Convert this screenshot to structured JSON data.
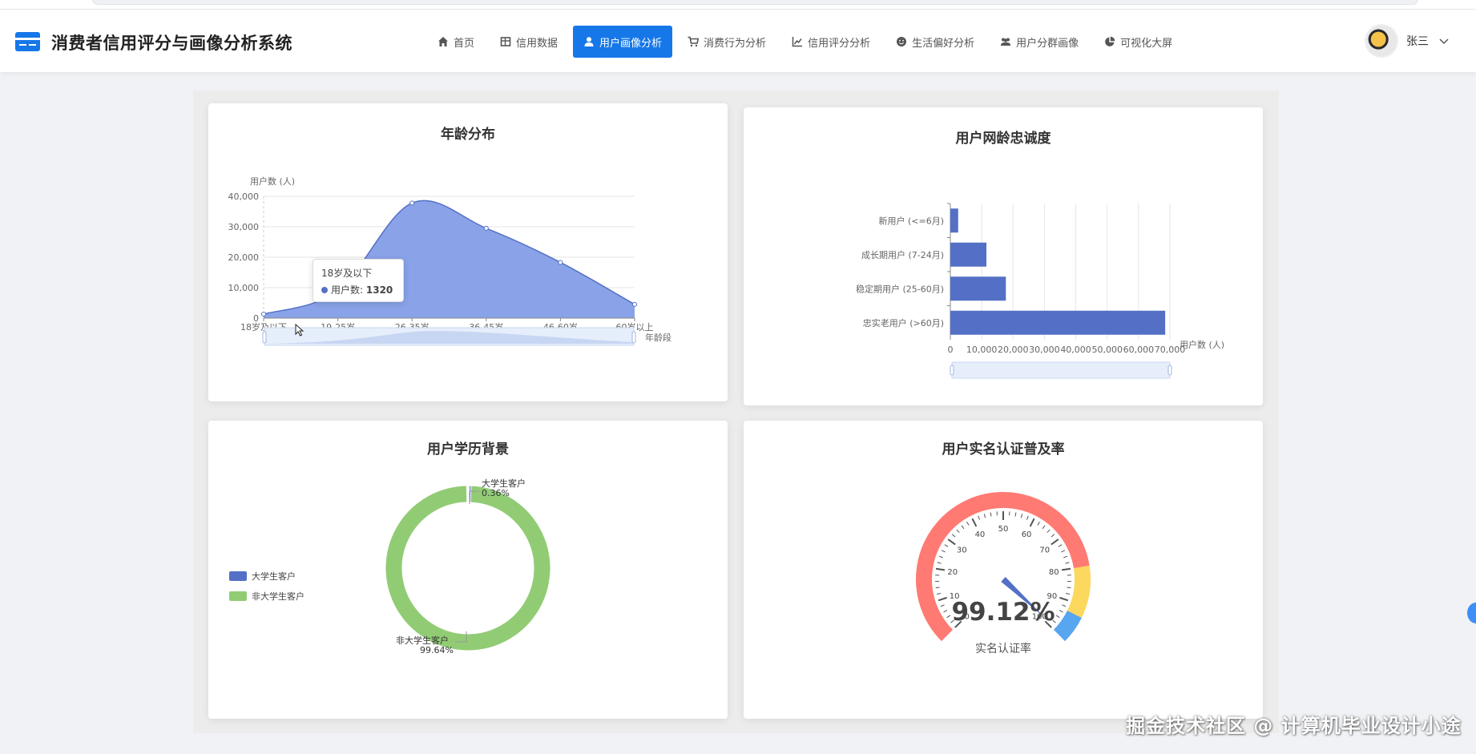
{
  "header": {
    "app_title": "消费者信用评分与画像分析系统",
    "nav": [
      {
        "label": "首页",
        "icon": "home-icon",
        "active": false
      },
      {
        "label": "信用数据",
        "icon": "table-icon",
        "active": false
      },
      {
        "label": "用户画像分析",
        "icon": "user-icon",
        "active": true
      },
      {
        "label": "消费行为分析",
        "icon": "cart-icon",
        "active": false
      },
      {
        "label": "信用评分分析",
        "icon": "line-chart-icon",
        "active": false
      },
      {
        "label": "生活偏好分析",
        "icon": "smile-icon",
        "active": false
      },
      {
        "label": "用户分群画像",
        "icon": "users-icon",
        "active": false
      },
      {
        "label": "可视化大屏",
        "icon": "pie-chart-icon",
        "active": false
      }
    ],
    "user_name": "张三"
  },
  "cards": {
    "age": {
      "title": "年龄分布",
      "ylabel": "用户数 (人)",
      "xlabel": "年龄段",
      "tooltip_title": "18岁及以下",
      "tooltip_series": "用户数:",
      "tooltip_value": "1320"
    },
    "tenure": {
      "title": "用户网龄忠诚度",
      "xlabel": "用户数 (人)"
    },
    "edu": {
      "title": "用户学历背景",
      "legend": [
        "大学生客户",
        "非大学生客户"
      ],
      "label_student": "大学生客户",
      "label_student_pct": "0.36%",
      "label_non": "非大学生客户",
      "label_non_pct": "99.64%"
    },
    "realname": {
      "title": "用户实名认证普及率",
      "value_text": "99.12%",
      "caption": "实名认证率"
    }
  },
  "colors": {
    "primary": "#1677e8",
    "series_blue": "#5470c6",
    "series_green": "#91cc75",
    "gauge_red": "#ff7a73",
    "gauge_yellow": "#fdd85e",
    "gauge_blue": "#58a5f0"
  },
  "chart_data": [
    {
      "type": "area",
      "title": "年龄分布",
      "xlabel": "年龄段",
      "ylabel": "用户数 (人)",
      "categories": [
        "18岁及以下",
        "19-25岁",
        "26-35岁",
        "36-45岁",
        "46-60岁",
        "60岁以上"
      ],
      "values": [
        1320,
        9000,
        37800,
        29500,
        18300,
        4500
      ],
      "ylim": [
        0,
        40000
      ],
      "yticks": [
        0,
        10000,
        20000,
        30000,
        40000
      ],
      "ytick_labels": [
        "0",
        "10,000",
        "20,000",
        "30,000",
        "40,000"
      ],
      "grid": true,
      "smooth": true
    },
    {
      "type": "bar",
      "orientation": "horizontal",
      "title": "用户网龄忠诚度",
      "xlabel": "用户数 (人)",
      "categories": [
        "新用户 (<=6月)",
        "成长期用户 (7-24月)",
        "稳定期用户 (25-60月)",
        "忠实老用户 (>60月)"
      ],
      "values": [
        2500,
        11500,
        17700,
        68500
      ],
      "xlim": [
        0,
        70000
      ],
      "xticks": [
        0,
        10000,
        20000,
        30000,
        40000,
        50000,
        60000,
        70000
      ],
      "xtick_labels": [
        "0",
        "10,000",
        "20,000",
        "30,000",
        "40,000",
        "50,000",
        "60,000",
        "70,000"
      ],
      "grid": true
    },
    {
      "type": "pie",
      "donut": true,
      "title": "用户学历背景",
      "categories": [
        "大学生客户",
        "非大学生客户"
      ],
      "values": [
        0.36,
        99.64
      ],
      "legend_position": "left"
    },
    {
      "type": "gauge",
      "title": "用户实名认证普及率",
      "value": 99.12,
      "range": [
        0,
        100
      ],
      "tick_labels": [
        "0",
        "10",
        "20",
        "30",
        "40",
        "50",
        "60",
        "70",
        "80",
        "90",
        "100"
      ],
      "caption": "实名认证率"
    }
  ]
}
